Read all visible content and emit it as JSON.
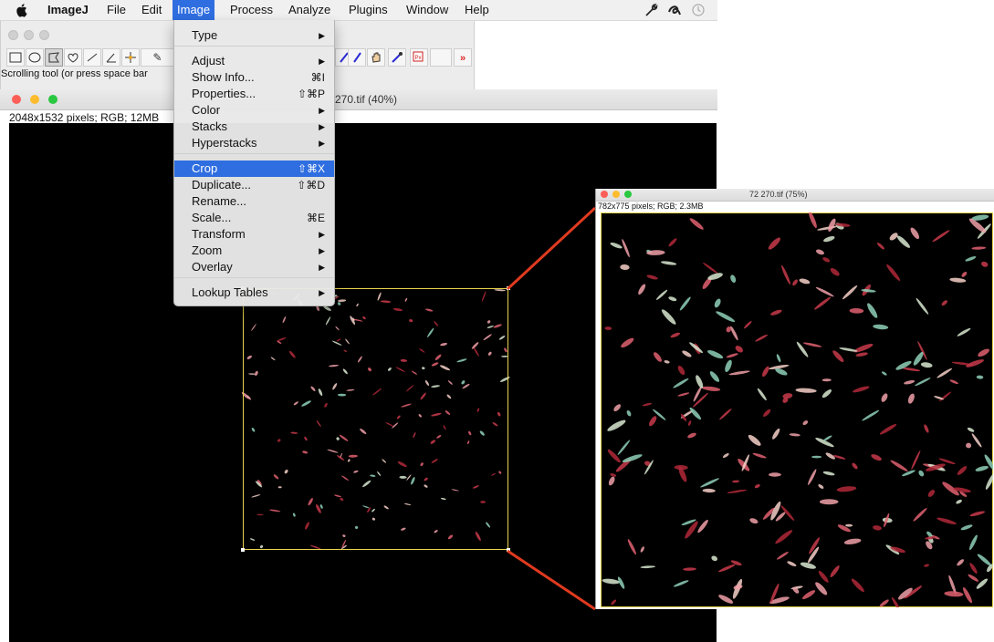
{
  "menubar": {
    "app_name": "ImageJ",
    "items": [
      "File",
      "Edit",
      "Image",
      "Process",
      "Analyze",
      "Plugins",
      "Window",
      "Help"
    ],
    "active_item": "Image"
  },
  "toolbar": {
    "status_text": "Scrolling tool (or press space bar"
  },
  "image_menu": {
    "items": [
      {
        "label": "Type",
        "shortcut": "",
        "submenu": true
      },
      {
        "label": "Adjust",
        "shortcut": "",
        "submenu": true
      },
      {
        "label": "Show Info...",
        "shortcut": "⌘I",
        "submenu": false
      },
      {
        "label": "Properties...",
        "shortcut": "⇧⌘P",
        "submenu": false
      },
      {
        "label": "Color",
        "shortcut": "",
        "submenu": true
      },
      {
        "label": "Stacks",
        "shortcut": "",
        "submenu": true
      },
      {
        "label": "Hyperstacks",
        "shortcut": "",
        "submenu": true
      },
      {
        "label": "Crop",
        "shortcut": "⇧⌘X",
        "submenu": false,
        "highlighted": true
      },
      {
        "label": "Duplicate...",
        "shortcut": "⇧⌘D",
        "submenu": false
      },
      {
        "label": "Rename...",
        "shortcut": "",
        "submenu": false
      },
      {
        "label": "Scale...",
        "shortcut": "⌘E",
        "submenu": false
      },
      {
        "label": "Transform",
        "shortcut": "",
        "submenu": true
      },
      {
        "label": "Zoom",
        "shortcut": "",
        "submenu": true
      },
      {
        "label": "Overlay",
        "shortcut": "",
        "submenu": true
      },
      {
        "label": "Lookup Tables",
        "shortcut": "",
        "submenu": true
      }
    ]
  },
  "image_window_1": {
    "title": "270.tif (40%)",
    "info": "2048x1532 pixels; RGB; 12MB"
  },
  "image_window_2": {
    "title": "72 270.tif (75%)",
    "info": "782x775 pixels; RGB; 2.3MB"
  },
  "colors": {
    "highlight": "#2f6ee0",
    "selection": "#e8d44d",
    "zoom_line": "#e03a1e",
    "close": "#fc5f57",
    "minimize": "#fdbc2e",
    "zoom": "#29c840"
  }
}
